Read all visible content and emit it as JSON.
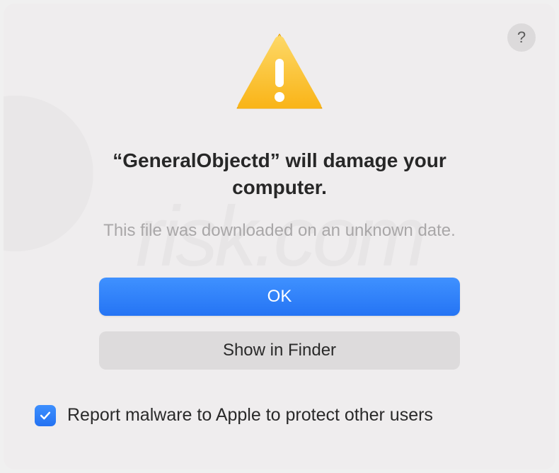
{
  "dialog": {
    "help_label": "?",
    "title": "“GeneralObjectd” will damage your computer.",
    "subtitle": "This file was downloaded on an unknown date.",
    "ok_label": "OK",
    "show_in_finder_label": "Show in Finder",
    "checkbox_label": "Report malware to Apple to protect other users",
    "checkbox_checked": true
  },
  "watermark": {
    "text": "risk.com"
  },
  "colors": {
    "primary_button": "#2e7ef6",
    "secondary_button": "#dddbdc",
    "background": "#efedee",
    "text_primary": "#272727",
    "text_secondary": "#a9a7a8"
  }
}
